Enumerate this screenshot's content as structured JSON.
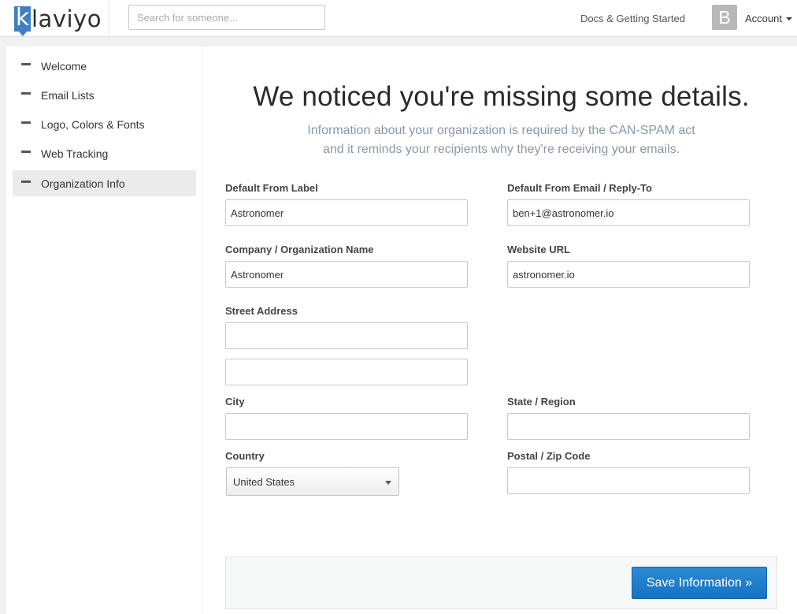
{
  "header": {
    "logo_letter": "k",
    "logo_rest": "laviyo",
    "search_placeholder": "Search for someone...",
    "docs_link": "Docs & Getting Started",
    "avatar_letter": "B",
    "account_label": "Account"
  },
  "sidebar": {
    "items": [
      {
        "label": "Welcome"
      },
      {
        "label": "Email Lists"
      },
      {
        "label": "Logo, Colors & Fonts"
      },
      {
        "label": "Web Tracking"
      },
      {
        "label": "Organization Info",
        "active": true
      }
    ]
  },
  "main": {
    "headline": "We noticed you're missing some details.",
    "subline_1": "Information about your organization is required by the CAN-SPAM act",
    "subline_2": "and it reminds your recipients why they're receiving your emails.",
    "fields": {
      "from_label": {
        "label": "Default From Label",
        "value": "Astronomer"
      },
      "from_email": {
        "label": "Default From Email / Reply-To",
        "value": "ben+1@astronomer.io"
      },
      "company": {
        "label": "Company / Organization Name",
        "value": "Astronomer"
      },
      "website": {
        "label": "Website URL",
        "value": "astronomer.io"
      },
      "street": {
        "label": "Street Address",
        "value_1": "",
        "value_2": ""
      },
      "city": {
        "label": "City",
        "value": ""
      },
      "state": {
        "label": "State / Region",
        "value": ""
      },
      "country": {
        "label": "Country",
        "selected": "United States"
      },
      "postal": {
        "label": "Postal / Zip Code",
        "value": ""
      }
    },
    "save_button": "Save Information »"
  },
  "colors": {
    "brand_blue": "#3f7fbf",
    "button_blue": "#1e7ecb",
    "subtext": "#8a98a8"
  }
}
